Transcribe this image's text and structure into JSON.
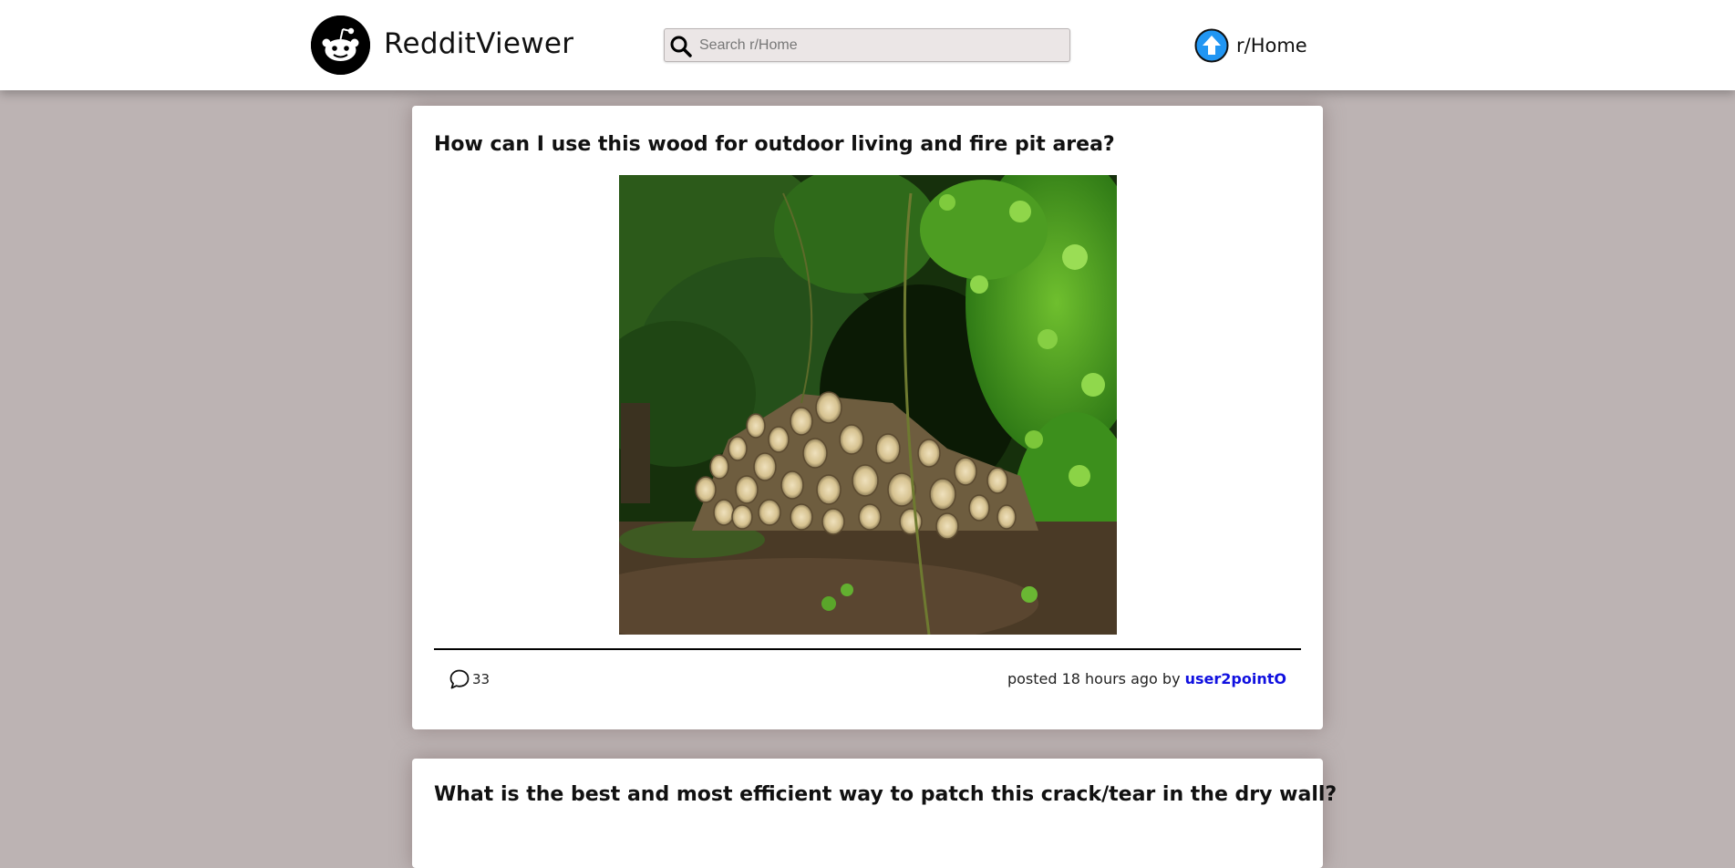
{
  "header": {
    "app_title": "RedditViewer",
    "search": {
      "placeholder": "Search r/Home",
      "value": ""
    },
    "community": {
      "label": "r/Home",
      "icon": "upvote-arrow-icon",
      "icon_color": "#2196f3"
    }
  },
  "posts": [
    {
      "title": "How can I use this wood for outdoor living and fire pit area?",
      "image": "stacked-logs-in-forest-photo",
      "comments_count": "33",
      "meta_prefix": "posted 18 hours ago by ",
      "author": "user2pointO"
    },
    {
      "title": "What is the best and most efficient way to patch this crack/tear in the dry wall?"
    }
  ],
  "colors": {
    "background": "#bcb3b3",
    "header": "#ffffff",
    "author_link": "#1010e0",
    "search_bg": "#ebe6e6"
  }
}
